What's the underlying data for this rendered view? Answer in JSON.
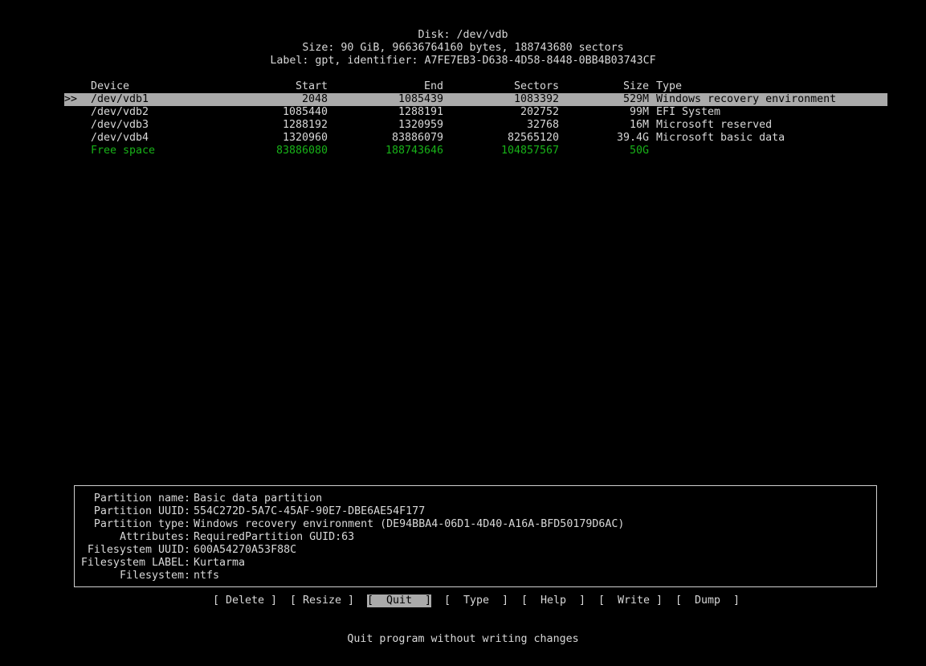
{
  "header": {
    "disk": "Disk: /dev/vdb",
    "size": "Size: 90 GiB, 96636764160 bytes, 188743680 sectors",
    "label": "Label: gpt, identifier: A7FE7EB3-D638-4D58-8448-0BB4B03743CF"
  },
  "table": {
    "columns": {
      "device": "Device",
      "start": "Start",
      "end": "End",
      "sectors": "Sectors",
      "size": "Size",
      "type": "Type"
    },
    "rows": [
      {
        "marker": ">>",
        "device": "/dev/vdb1",
        "start": "2048",
        "end": "1085439",
        "sectors": "1083392",
        "size": "529M",
        "type": "Windows recovery environment"
      },
      {
        "marker": "",
        "device": "/dev/vdb2",
        "start": "1085440",
        "end": "1288191",
        "sectors": "202752",
        "size": "99M",
        "type": "EFI System"
      },
      {
        "marker": "",
        "device": "/dev/vdb3",
        "start": "1288192",
        "end": "1320959",
        "sectors": "32768",
        "size": "16M",
        "type": "Microsoft reserved"
      },
      {
        "marker": "",
        "device": "/dev/vdb4",
        "start": "1320960",
        "end": "83886079",
        "sectors": "82565120",
        "size": "39.4G",
        "type": "Microsoft basic data"
      },
      {
        "marker": "",
        "device": "Free space",
        "start": "83886080",
        "end": "188743646",
        "sectors": "104857567",
        "size": "50G",
        "type": ""
      }
    ]
  },
  "info": {
    "rows": [
      {
        "label": "Partition name:",
        "value": "Basic data partition"
      },
      {
        "label": "Partition UUID:",
        "value": "554C272D-5A7C-45AF-90E7-DBE6AE54F177"
      },
      {
        "label": "Partition type:",
        "value": "Windows recovery environment (DE94BBA4-06D1-4D40-A16A-BFD50179D6AC)"
      },
      {
        "label": "Attributes:",
        "value": "RequiredPartition GUID:63"
      },
      {
        "label": "Filesystem UUID:",
        "value": "600A54270A53F88C"
      },
      {
        "label": "Filesystem LABEL:",
        "value": "Kurtarma"
      },
      {
        "label": "Filesystem:",
        "value": "ntfs"
      }
    ]
  },
  "menu": {
    "delete": "[ Delete ]",
    "resize": "[ Resize ]",
    "quit": "[  Quit  ]",
    "type": "[  Type  ]",
    "help": "[  Help  ]",
    "write": "[  Write ]",
    "dump": "[  Dump  ]"
  },
  "status": "Quit program without writing changes",
  "colors": {
    "selected_bg": "#aaaaaa",
    "free_space": "#18b218",
    "text": "#d8d8d8",
    "background": "#000000"
  }
}
